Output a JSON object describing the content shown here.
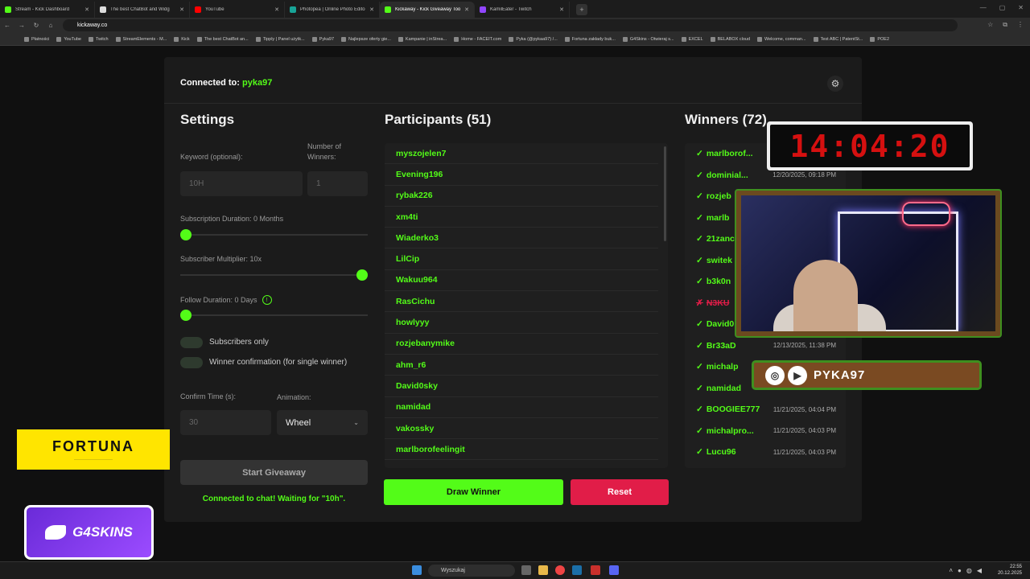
{
  "browser": {
    "tabs": [
      {
        "label": "Stream - Kick Dashboard",
        "color": "#53fc18"
      },
      {
        "label": "The best ChatBot and Widg",
        "color": "#ddd"
      },
      {
        "label": "YouTube",
        "color": "#ff0000"
      },
      {
        "label": "Photopea | Online Photo Editor",
        "color": "#18a497"
      },
      {
        "label": "Kickaway - Kick Giveaway Tool",
        "color": "#53fc18",
        "active": true
      },
      {
        "label": "KamilEater - Twitch",
        "color": "#9146ff"
      }
    ],
    "url": "kickaway.co",
    "bookmarks": [
      "Płatności",
      "YouTube",
      "Twitch",
      "StreamElements - M...",
      "Kick",
      "The best ChatBot an...",
      "Tipply | Panel użytk...",
      "Pyka97",
      "Najlepsze oferty gie...",
      "Kampanie | inStrea...",
      "Home - FACEIT.com",
      "Pyka (@pykaa97) /...",
      "Fortuna zakłady buk...",
      "G4Skins - Otwieraj s...",
      "EXCEL",
      "BELABOX cloud",
      "Welcome, comman...",
      "Test ABC | PatentSt...",
      "POE2"
    ]
  },
  "app": {
    "connected_label": "Connected to:",
    "connected_user": "pyka97",
    "settings": {
      "title": "Settings",
      "keyword_label": "Keyword (optional):",
      "keyword_value": "10H",
      "winners_label": "Number of Winners:",
      "winners_value": "1",
      "sub_duration_label": "Subscription Duration: 0 Months",
      "sub_duration_value": 0,
      "sub_multiplier_label": "Subscriber Multiplier: 10x",
      "sub_multiplier_value": 1.0,
      "follow_duration_label": "Follow Duration: 0 Days",
      "follow_duration_value": 0,
      "subs_only_label": "Subscribers only",
      "winner_confirm_label": "Winner confirmation (for single winner)",
      "confirm_time_label": "Confirm Time (s):",
      "confirm_time_value": "30",
      "animation_label": "Animation:",
      "animation_value": "Wheel",
      "start_label": "Start Giveaway",
      "status": "Connected to chat! Waiting for \"10h\"."
    },
    "participants": {
      "title": "Participants (51)",
      "items": [
        "myszojelen7",
        "Evening196",
        "rybak226",
        "xm4ti",
        "Wiaderko3",
        "LilCip",
        "Wakuu964",
        "RasCichu",
        "howlyyy",
        "rozjebanymike",
        "ahm_r6",
        "David0sky",
        "namidad",
        "vakossky",
        "marlborofeelingit"
      ],
      "draw_label": "Draw Winner",
      "reset_label": "Reset"
    },
    "winners": {
      "title": "Winners (72)",
      "items": [
        {
          "name": "marlborof...",
          "date": ""
        },
        {
          "name": "dominial...",
          "date": "12/20/2025, 09:18 PM"
        },
        {
          "name": "rozjeb",
          "date": ""
        },
        {
          "name": "marlb",
          "date": ""
        },
        {
          "name": "21zanc",
          "date": ""
        },
        {
          "name": "switek",
          "date": ""
        },
        {
          "name": "b3k0n",
          "date": ""
        },
        {
          "name": "N3KU",
          "date": "",
          "rejected": true
        },
        {
          "name": "David0",
          "date": ""
        },
        {
          "name": "Br33aD",
          "date": "12/13/2025, 11:38 PM"
        },
        {
          "name": "michalp",
          "date": ""
        },
        {
          "name": "namidad",
          "date": ""
        },
        {
          "name": "BOOGIEE777",
          "date": "11/21/2025, 04:04 PM"
        },
        {
          "name": "michalpro...",
          "date": "11/21/2025, 04:03 PM"
        },
        {
          "name": "Lucu96",
          "date": "11/21/2025, 04:03 PM"
        }
      ]
    }
  },
  "overlay": {
    "timer": "14:04:20",
    "social_name": "PYKA97",
    "fortuna": "FORTUNA",
    "g4skins": "G4SKINS"
  },
  "taskbar": {
    "search": "Wyszukaj",
    "time": "22:55",
    "date": "20.12.2025"
  }
}
